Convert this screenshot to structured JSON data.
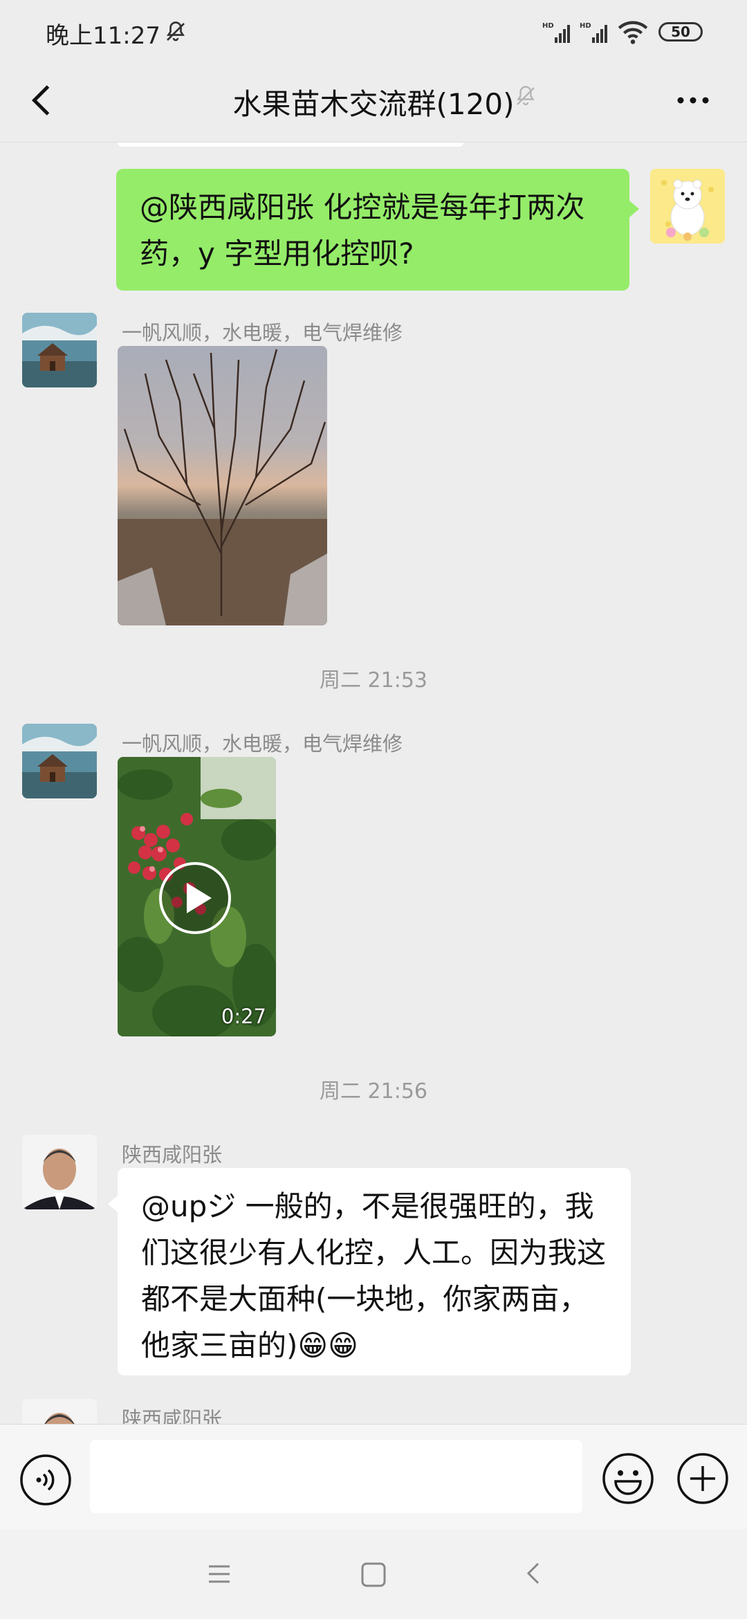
{
  "status_bar": {
    "time": "晚上11:27",
    "battery": "50"
  },
  "header": {
    "title": "水果苗木交流群(120)"
  },
  "messages": [
    {
      "text": "@陕西咸阳张  化控就是每年打两次药，y 字型用化控呗?"
    },
    {
      "sender": "一帆风顺，水电暖，电气焊维修"
    },
    {
      "timestamp": "周二 21:53"
    },
    {
      "sender": "一帆风顺，水电暖，电气焊维修",
      "video_duration": "0:27"
    },
    {
      "timestamp": "周二 21:56"
    },
    {
      "sender": "陕西咸阳张",
      "text": "@upジ 一般的，不是很强旺的，我们这很少有人化控，人工。因为我这都不是大面种(一块地，你家两亩，他家三亩的)😁😁"
    },
    {
      "sender": "陕西咸阳张"
    }
  ],
  "colors": {
    "self_bubble": "#95ec69",
    "other_bubble": "#ffffff",
    "background": "#ededed"
  }
}
